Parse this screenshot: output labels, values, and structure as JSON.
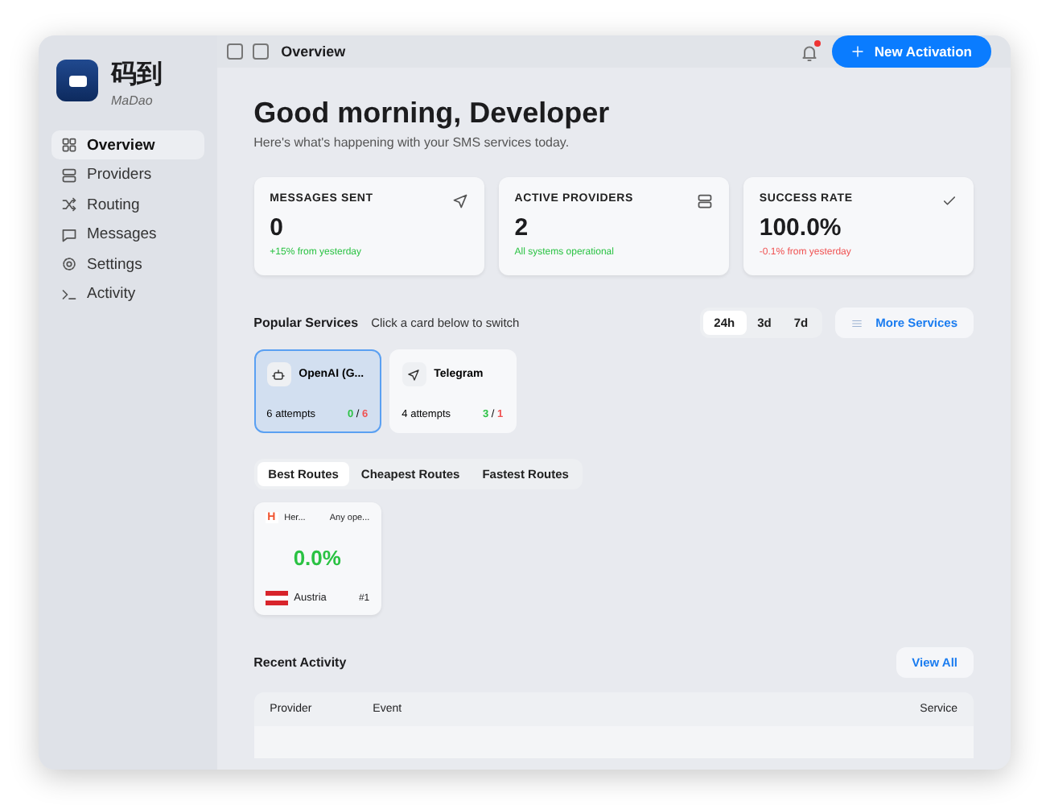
{
  "app": {
    "title": "码到",
    "subtitle": "MaDao"
  },
  "sidebar": {
    "items": [
      {
        "label": "Overview",
        "selected": true
      },
      {
        "label": "Providers",
        "selected": false
      },
      {
        "label": "Routing",
        "selected": false
      },
      {
        "label": "Messages",
        "selected": false
      },
      {
        "label": "Settings",
        "selected": false
      },
      {
        "label": "Activity",
        "selected": false
      }
    ]
  },
  "topbar": {
    "title": "Overview",
    "notification": true,
    "button": "New Activation"
  },
  "greeting": {
    "title": "Good morning, Developer",
    "subtitle": "Here's what's happening with your SMS services today."
  },
  "stats": [
    {
      "label": "MESSAGES SENT",
      "value": "0",
      "note": "+15% from yesterday",
      "color": "#2ac243"
    },
    {
      "label": "ACTIVE PROVIDERS",
      "value": "2",
      "note": "All systems operational",
      "color": "#2ac243"
    },
    {
      "label": "SUCCESS RATE",
      "value": "100.0%",
      "note": "-0.1% from yesterday",
      "color": "#f05252"
    }
  ],
  "popular": {
    "title": "Popular Services",
    "hint": "Click a card below to switch",
    "ranges": [
      {
        "label": "24h",
        "selected": true
      },
      {
        "label": "3d",
        "selected": false
      },
      {
        "label": "7d",
        "selected": false
      }
    ],
    "more": "More Services",
    "services": [
      {
        "name": "OpenAI (G...",
        "attempts": "6 attempts",
        "success": "0",
        "separator": "/",
        "failed": "6",
        "selected": true
      },
      {
        "name": "Telegram",
        "attempts": "4 attempts",
        "success": "3",
        "separator": "/",
        "failed": "1",
        "selected": false
      }
    ]
  },
  "routes": {
    "tabs": [
      {
        "label": "Best Routes",
        "selected": true
      },
      {
        "label": "Cheapest Routes",
        "selected": false
      },
      {
        "label": "Fastest Routes",
        "selected": false
      }
    ],
    "cards": [
      {
        "provider_mark": "H",
        "provider": "Her...",
        "operator": "Any ope...",
        "rate": "0.0%",
        "country": "Austria",
        "rank": "#1"
      }
    ]
  },
  "activity": {
    "title": "Recent Activity",
    "view_all": "View All",
    "columns": [
      "Provider",
      "Event",
      "Service"
    ]
  }
}
